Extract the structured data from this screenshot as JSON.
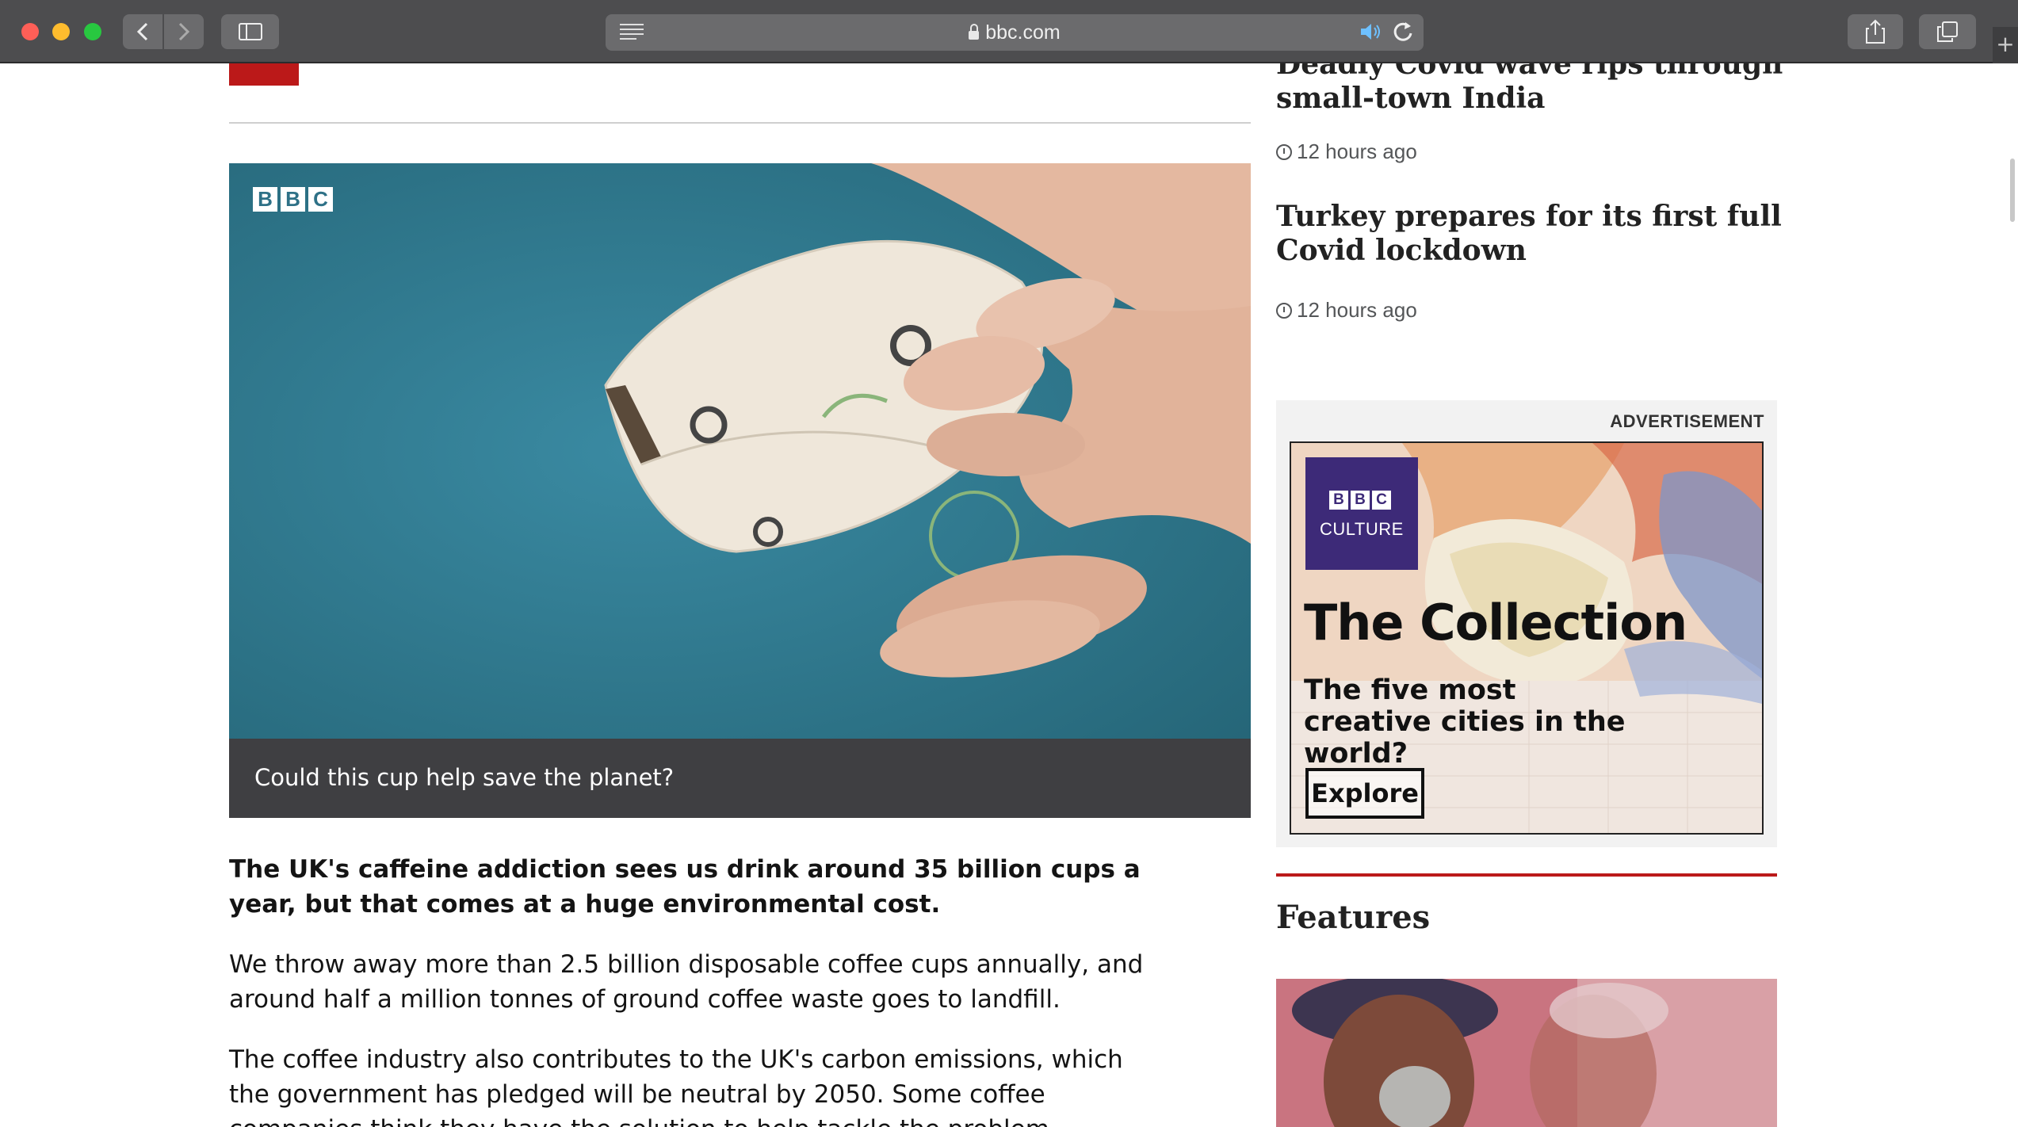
{
  "browser": {
    "url": "bbc.com",
    "back_icon": "chevron-left-icon",
    "forward_icon": "chevron-right-icon",
    "sidebar_icon": "sidebar-icon",
    "reader_icon": "reader-view-icon",
    "speaker_icon": "speaker-icon",
    "reload_icon": "reload-icon",
    "share_icon": "share-icon",
    "tabs_icon": "tab-overview-icon",
    "new_tab": "+"
  },
  "article": {
    "video_logo": [
      "B",
      "B",
      "C"
    ],
    "video_caption": "Could this cup help save the planet?",
    "lead": "The UK's caffeine addiction sees us drink around 35 billion cups a year, but that comes at a huge environmental cost.",
    "paragraph_2": "We throw away more than 2.5 billion disposable coffee cups annually, and around half a million tonnes of ground coffee waste goes to landfill.",
    "paragraph_3": "The coffee industry also contributes to the UK's carbon emissions, which the government has pledged will be neutral by 2050. Some coffee companies think they have the solution to help tackle the problem."
  },
  "sidebar": {
    "stories": [
      {
        "title": "Deadly Covid wave rips through small-town India",
        "time": "12 hours ago"
      },
      {
        "title": "Turkey prepares for its first full Covid lockdown",
        "time": "12 hours ago"
      }
    ],
    "advertisement_label": "ADVERTISEMENT",
    "ad": {
      "badge_logo": [
        "B",
        "B",
        "C"
      ],
      "badge_text": "CULTURE",
      "heading": "The Collection",
      "subheading": "The five most creative cities in the world?",
      "button": "Explore"
    },
    "features_title": "Features"
  },
  "colors": {
    "bbc_red": "#bb1919",
    "video_bg": "#2e7187",
    "caption_bg": "#3f3f42",
    "culture_purple": "#3d2a78"
  }
}
